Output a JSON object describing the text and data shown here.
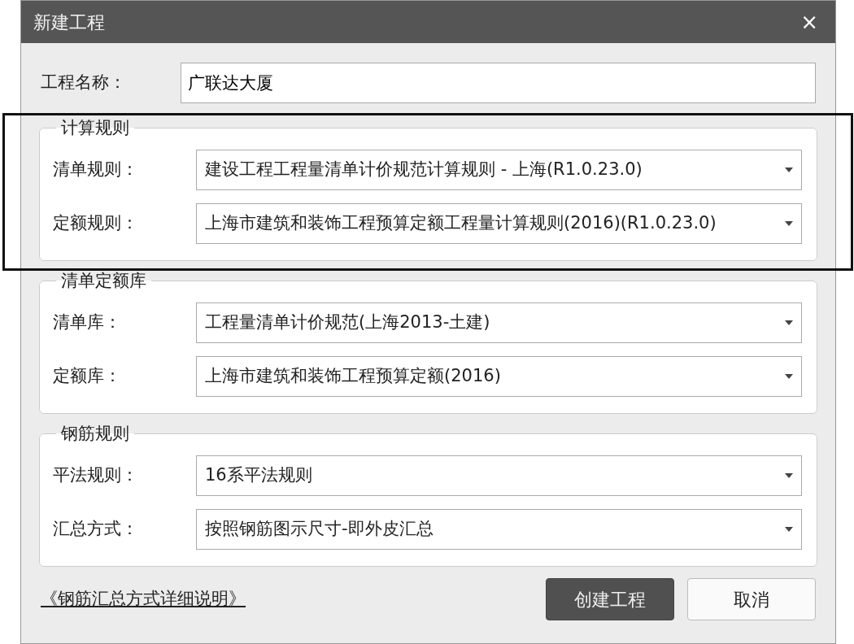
{
  "window": {
    "title": "新建工程",
    "close": "×"
  },
  "project_name": {
    "label": "工程名称：",
    "value": "广联达大厦"
  },
  "groups": [
    {
      "title": "计算规则",
      "highlighted": true,
      "fields": [
        {
          "label": "清单规则：",
          "value": "建设工程工程量清单计价规范计算规则 - 上海(R1.0.23.0)"
        },
        {
          "label": "定额规则：",
          "value": "上海市建筑和装饰工程预算定额工程量计算规则(2016)(R1.0.23.0)"
        }
      ]
    },
    {
      "title": "清单定额库",
      "highlighted": false,
      "fields": [
        {
          "label": "清单库：",
          "value": "工程量清单计价规范(上海2013-土建)"
        },
        {
          "label": "定额库：",
          "value": "上海市建筑和装饰工程预算定额(2016)"
        }
      ]
    },
    {
      "title": "钢筋规则",
      "highlighted": false,
      "fields": [
        {
          "label": "平法规则：",
          "value": "16系平法规则"
        },
        {
          "label": "汇总方式：",
          "value": "按照钢筋图示尺寸-即外皮汇总"
        }
      ]
    }
  ],
  "footer": {
    "link": "《钢筋汇总方式详细说明》",
    "buttons": [
      {
        "label": "创建工程",
        "primary": true
      },
      {
        "label": "取消",
        "primary": false
      }
    ]
  }
}
